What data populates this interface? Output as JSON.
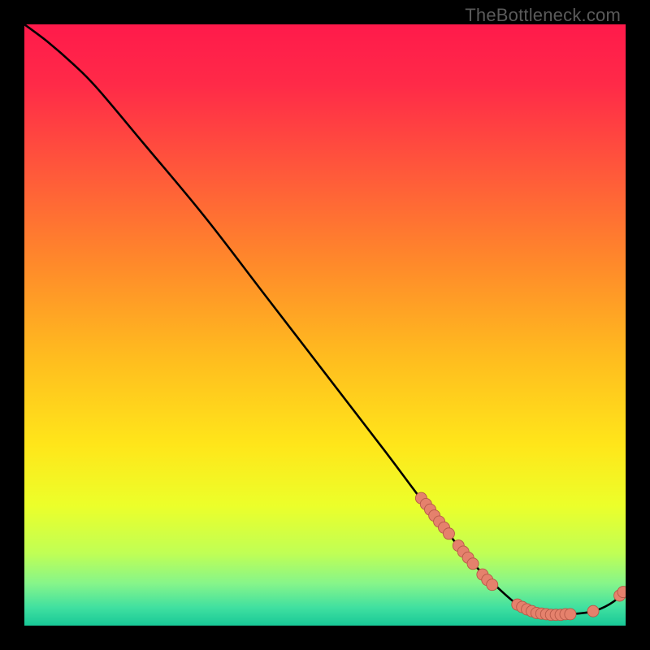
{
  "watermark": "TheBottleneck.com",
  "colors": {
    "gradient_stops": [
      {
        "offset": 0.0,
        "color": "#ff1a4b"
      },
      {
        "offset": 0.1,
        "color": "#ff2a48"
      },
      {
        "offset": 0.25,
        "color": "#ff5a3a"
      },
      {
        "offset": 0.4,
        "color": "#ff8a2a"
      },
      {
        "offset": 0.55,
        "color": "#ffbb1f"
      },
      {
        "offset": 0.7,
        "color": "#ffe61a"
      },
      {
        "offset": 0.8,
        "color": "#ecff2a"
      },
      {
        "offset": 0.88,
        "color": "#c0ff55"
      },
      {
        "offset": 0.93,
        "color": "#86f58a"
      },
      {
        "offset": 0.97,
        "color": "#40e0a0"
      },
      {
        "offset": 1.0,
        "color": "#18c897"
      }
    ],
    "curve_stroke": "#000000",
    "marker_fill": "#e5816c",
    "marker_stroke": "#b65948",
    "background": "#000000"
  },
  "chart_data": {
    "type": "line",
    "title": "",
    "xlabel": "",
    "ylabel": "",
    "xlim": [
      0,
      100
    ],
    "ylim": [
      0,
      100
    ],
    "curve": [
      {
        "x": 0,
        "y": 100
      },
      {
        "x": 4,
        "y": 97
      },
      {
        "x": 8,
        "y": 93.5
      },
      {
        "x": 12,
        "y": 89.5
      },
      {
        "x": 20,
        "y": 80
      },
      {
        "x": 30,
        "y": 68
      },
      {
        "x": 40,
        "y": 55
      },
      {
        "x": 50,
        "y": 42
      },
      {
        "x": 60,
        "y": 29
      },
      {
        "x": 66,
        "y": 21
      },
      {
        "x": 70,
        "y": 16
      },
      {
        "x": 74,
        "y": 11
      },
      {
        "x": 78,
        "y": 7
      },
      {
        "x": 82,
        "y": 3.5
      },
      {
        "x": 85,
        "y": 2
      },
      {
        "x": 88,
        "y": 1.8
      },
      {
        "x": 92,
        "y": 2
      },
      {
        "x": 95,
        "y": 2.5
      },
      {
        "x": 98,
        "y": 4
      },
      {
        "x": 100,
        "y": 6
      }
    ],
    "markers": [
      {
        "x": 66.0,
        "y": 21.2
      },
      {
        "x": 66.8,
        "y": 20.2
      },
      {
        "x": 67.5,
        "y": 19.3
      },
      {
        "x": 68.2,
        "y": 18.3
      },
      {
        "x": 69.0,
        "y": 17.3
      },
      {
        "x": 69.8,
        "y": 16.3
      },
      {
        "x": 70.6,
        "y": 15.3
      },
      {
        "x": 72.2,
        "y": 13.3
      },
      {
        "x": 73.0,
        "y": 12.3
      },
      {
        "x": 73.8,
        "y": 11.3
      },
      {
        "x": 74.6,
        "y": 10.3
      },
      {
        "x": 76.2,
        "y": 8.5
      },
      {
        "x": 77.0,
        "y": 7.6
      },
      {
        "x": 77.8,
        "y": 6.8
      },
      {
        "x": 82.0,
        "y": 3.5
      },
      {
        "x": 82.8,
        "y": 3.1
      },
      {
        "x": 83.6,
        "y": 2.7
      },
      {
        "x": 84.4,
        "y": 2.4
      },
      {
        "x": 85.2,
        "y": 2.1
      },
      {
        "x": 86.0,
        "y": 2.0
      },
      {
        "x": 86.8,
        "y": 1.9
      },
      {
        "x": 87.6,
        "y": 1.8
      },
      {
        "x": 88.4,
        "y": 1.8
      },
      {
        "x": 89.2,
        "y": 1.8
      },
      {
        "x": 90.0,
        "y": 1.9
      },
      {
        "x": 90.8,
        "y": 1.9
      },
      {
        "x": 94.6,
        "y": 2.4
      },
      {
        "x": 99.0,
        "y": 5.0
      },
      {
        "x": 99.6,
        "y": 5.6
      }
    ]
  }
}
